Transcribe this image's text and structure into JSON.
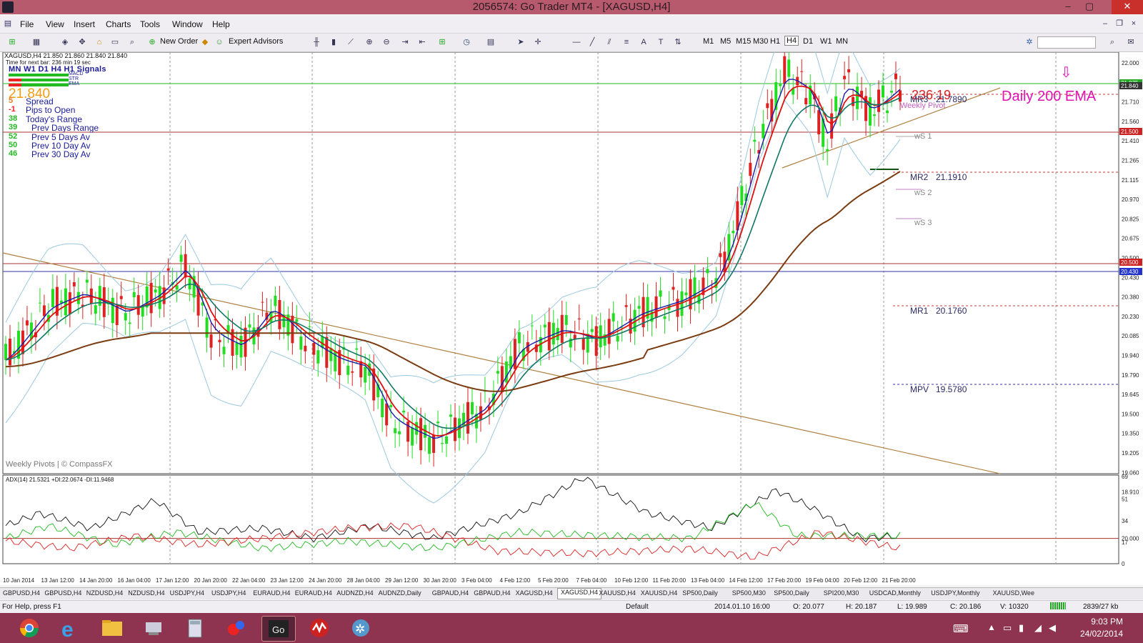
{
  "window": {
    "title": "2056574: Go Trader MT4 - [XAGUSD,H4]",
    "minimize": "–",
    "maximize": "▢",
    "close": "✕"
  },
  "menu": [
    "File",
    "View",
    "Insert",
    "Charts",
    "Tools",
    "Window",
    "Help"
  ],
  "toolbar": {
    "new_order": "New Order",
    "expert_advisors": "Expert Advisors",
    "timeframes": [
      "M1",
      "M5",
      "M15",
      "M30",
      "H1",
      "H4",
      "D1",
      "W1",
      "MN"
    ],
    "active_timeframe": "H4"
  },
  "chart": {
    "header": "XAGUSD,H4  21.850 21.860 21.840 21.840",
    "time_next_bar": "Time for next bar: 236 min 19 sec",
    "signals_title": "MN W1 D1  H4  H1  Signals",
    "signal_labels": [
      "MACD",
      "STR",
      "EMA"
    ],
    "price_big": "21.840",
    "stats": [
      {
        "value": "5",
        "label": "Spread"
      },
      {
        "value": "-1",
        "label": "Pips to Open"
      },
      {
        "value": "38",
        "label": "Today's Range"
      },
      {
        "value": "39",
        "label": "Prev Days Range"
      },
      {
        "value": "52",
        "label": "Prev 5 Days Av"
      },
      {
        "value": "50",
        "label": "Prev 10 Day Av"
      },
      {
        "value": "46",
        "label": "Prev 30 Day Av"
      }
    ],
    "watermark": "Weekly Pivots | © CompassFX",
    "annotation": "Daily 200 EMA",
    "arrow_glyph": "⇩",
    "countdown": "236:19",
    "pivots": [
      {
        "label": "MR3",
        "value": "21.7890"
      },
      {
        "label": "Weekly Pivot",
        "value": ""
      },
      {
        "label": "wS 1",
        "value": ""
      },
      {
        "label": "MR2",
        "value": "21.1910"
      },
      {
        "label": "wS 2",
        "value": ""
      },
      {
        "label": "wS 3",
        "value": ""
      },
      {
        "label": "MR1",
        "value": "20.1760"
      },
      {
        "label": "MPV",
        "value": "19.5780"
      }
    ],
    "y_axis_labels": [
      "22.000",
      "21.840",
      "21.710",
      "21.560",
      "21.410",
      "21.265",
      "21.115",
      "20.970",
      "20.825",
      "20.675",
      "20.500",
      "20.430",
      "20.380",
      "20.230",
      "20.085",
      "19.940",
      "19.790",
      "19.645",
      "19.500",
      "19.350",
      "19.205",
      "19.060",
      "18.910"
    ],
    "price_tags": [
      {
        "text": "21.875",
        "color": "#22aa22"
      },
      {
        "text": "21.840",
        "color": "#333333"
      },
      {
        "text": "21.500",
        "color": "#cc2222"
      },
      {
        "text": "20.500",
        "color": "#cc2222"
      },
      {
        "text": "20.430",
        "color": "#2233cc"
      }
    ],
    "adx_header": "ADX(14) 21.5321 +DI:22.0674 -DI:11.9468",
    "adx_axis": [
      "69",
      "51",
      "34",
      "20.000",
      "17",
      "0"
    ],
    "x_labels": [
      "10 Jan 2014",
      "13 Jan 12:00",
      "14 Jan 20:00",
      "16 Jan 04:00",
      "17 Jan 12:00",
      "20 Jan 20:00",
      "22 Jan 04:00",
      "23 Jan 12:00",
      "24 Jan 20:00",
      "28 Jan 04:00",
      "29 Jan 12:00",
      "30 Jan 20:00",
      "3 Feb 04:00",
      "4 Feb 12:00",
      "5 Feb 20:00",
      "7 Feb 04:00",
      "10 Feb 12:00",
      "11 Feb 20:00",
      "13 Feb 04:00",
      "14 Feb 12:00",
      "17 Feb 20:00",
      "19 Feb 04:00",
      "20 Feb 12:00",
      "21 Feb 20:00"
    ]
  },
  "tabs": [
    "GBPUSD,H4",
    "GBPUSD,H4",
    "NZDUSD,H4",
    "NZDUSD,H4",
    "USDJPY,H4",
    "USDJPY,H4",
    "EURAUD,H4",
    "EURAUD,H4",
    "AUDNZD,H4",
    "AUDNZD,Daily",
    "GBPAUD,H4",
    "GBPAUD,H4",
    "XAGUSD,H4",
    "XAGUSD,H4",
    "XAUUSD,H4",
    "XAUUSD,H4",
    "SP500,Daily",
    "SP500,M30",
    "SP500,Daily",
    "SPI200,M30",
    "USDCAD,Monthly",
    "USDJPY,Monthly",
    "XAUUSD,Wee"
  ],
  "active_tab_index": 13,
  "status": {
    "help": "For Help, press F1",
    "profile": "Default",
    "datetime": "2014.01.10 16:00",
    "open": "O: 20.077",
    "high": "H: 20.187",
    "low": "L: 19.989",
    "close": "C: 20.186",
    "volume": "V: 10320",
    "traffic": "2839/27 kb"
  },
  "taskbar": {
    "time": "9:03 PM",
    "date": "24/02/2014"
  }
}
